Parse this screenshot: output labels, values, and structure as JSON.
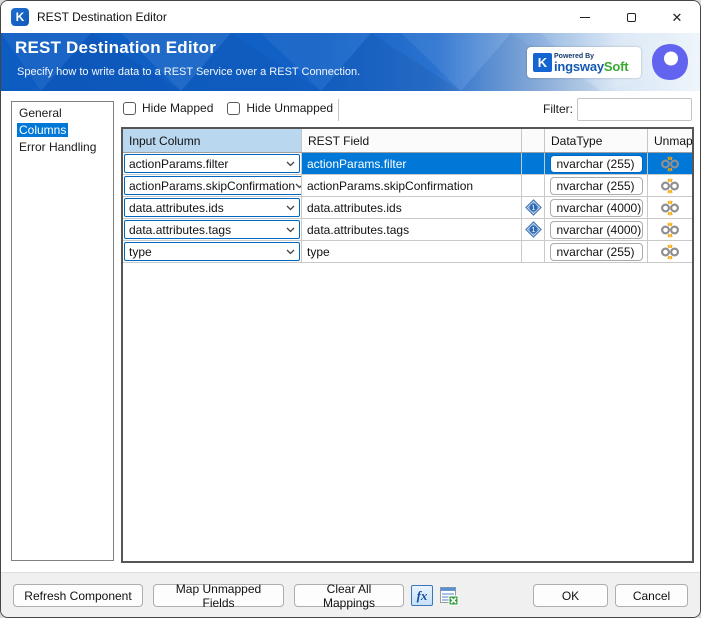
{
  "window": {
    "title": "REST Destination Editor",
    "icon_letter": "K",
    "controls": {
      "minimize": "minimize",
      "maximize": "maximize",
      "close": "close"
    }
  },
  "header": {
    "title": "REST Destination Editor",
    "subtitle": "Specify how to write data to a REST Service over a REST Connection.",
    "brand": {
      "powered_by": "Powered By",
      "k": "K",
      "name": "ingsway",
      "soft": "Soft"
    },
    "colors": {
      "banner_blue": "#0d5cc1",
      "logo_purple": "#6264f0"
    }
  },
  "sidebar": {
    "items": [
      {
        "label": "General",
        "selected": false
      },
      {
        "label": "Columns",
        "selected": true
      },
      {
        "label": "Error Handling",
        "selected": false
      }
    ]
  },
  "toolbar": {
    "hide_mapped": {
      "label": "Hide Mapped",
      "checked": false
    },
    "hide_unmapped": {
      "label": "Hide Unmapped",
      "checked": false
    },
    "filter_label": "Filter:",
    "filter_value": ""
  },
  "table": {
    "columns": [
      "Input Column",
      "REST Field",
      "",
      "DataType",
      "Unmap"
    ],
    "selection_color": "#0078d7",
    "rows": [
      {
        "input_column": "actionParams.filter",
        "rest_field": "actionParams.filter",
        "info_icon": false,
        "datatype": "nvarchar (255)",
        "selected": true
      },
      {
        "input_column": "actionParams.skipConfirmation",
        "rest_field": "actionParams.skipConfirmation",
        "info_icon": false,
        "datatype": "nvarchar (255)",
        "selected": false
      },
      {
        "input_column": "data.attributes.ids",
        "rest_field": "data.attributes.ids",
        "info_icon": true,
        "datatype": "nvarchar (4000)",
        "selected": false
      },
      {
        "input_column": "data.attributes.tags",
        "rest_field": "data.attributes.tags",
        "info_icon": true,
        "datatype": "nvarchar (4000)",
        "selected": false
      },
      {
        "input_column": "type",
        "rest_field": "type",
        "info_icon": false,
        "datatype": "nvarchar (255)",
        "selected": false
      }
    ]
  },
  "footer": {
    "refresh_label": "Refresh Component",
    "map_label": "Map Unmapped Fields",
    "clear_label": "Clear All Mappings",
    "fx_label": "fx",
    "ok_label": "OK",
    "cancel_label": "Cancel"
  }
}
